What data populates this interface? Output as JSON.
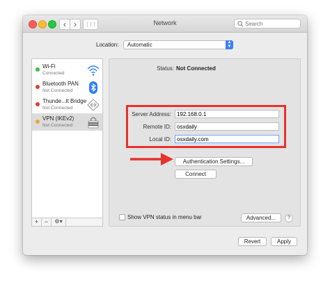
{
  "window": {
    "title": "Network",
    "back_glyph": "‹",
    "forward_glyph": "›",
    "grid_glyph": "⋮⋮⋮"
  },
  "search": {
    "placeholder": "Search"
  },
  "location": {
    "label": "Location:",
    "value": "Automatic"
  },
  "services": [
    {
      "name": "Wi-Fi",
      "status": "Connected",
      "status_color": "#3cc13b",
      "icon": "wifi-icon",
      "selected": false
    },
    {
      "name": "Bluetooth PAN",
      "status": "Not Connected",
      "status_color": "#e33b32",
      "icon": "bluetooth-icon",
      "selected": false
    },
    {
      "name": "Thunde...lt Bridge",
      "status": "Not Connected",
      "status_color": "#e33b32",
      "icon": "thunderbolt-bridge-icon",
      "selected": false
    },
    {
      "name": "VPN (IKEv2)",
      "status": "Not Connected",
      "status_color": "#f0a830",
      "icon": "vpn-lock-icon",
      "selected": true
    }
  ],
  "sidebar_tools": {
    "add": "+",
    "remove": "−",
    "gear": "⚙▾"
  },
  "detail": {
    "status_label": "Status:",
    "status_value": "Not Connected",
    "server_address_label": "Server Address:",
    "server_address_value": "192.168.0.1",
    "remote_id_label": "Remote ID:",
    "remote_id_value": "osxdaily",
    "local_id_label": "Local ID:",
    "local_id_value": "osxdaily.com",
    "auth_button": "Authentication Settings...",
    "connect_button": "Connect",
    "show_vpn_status_label": "Show VPN status in menu bar",
    "advanced_button": "Advanced...",
    "help_button": "?"
  },
  "footer": {
    "revert_button": "Revert",
    "apply_button": "Apply"
  },
  "colors": {
    "annotation_red": "#e8322c",
    "accent_blue": "#3b82f6"
  }
}
